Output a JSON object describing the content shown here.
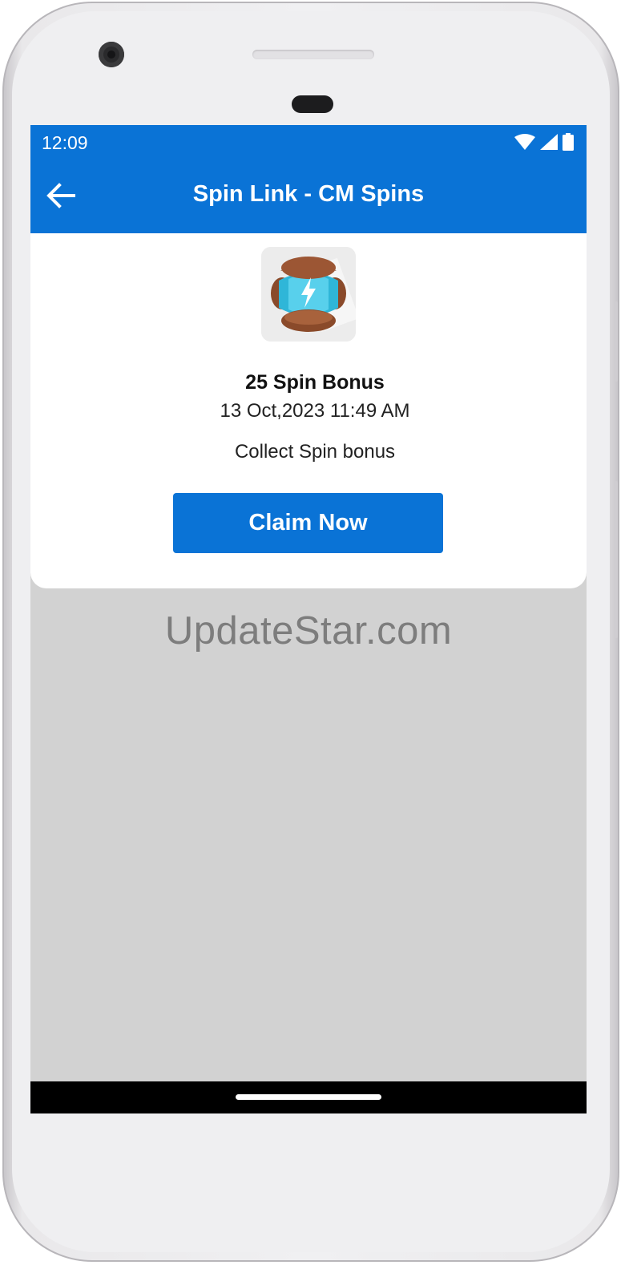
{
  "status_bar": {
    "time": "12:09",
    "icons": [
      "wifi-icon",
      "cellular-signal-icon",
      "battery-icon"
    ]
  },
  "app_bar": {
    "title": "Spin Link - CM Spins",
    "back_icon": "arrow-left-icon"
  },
  "card": {
    "image": "coin-master-spin-icon",
    "title": "25 Spin Bonus",
    "date": "13 Oct,2023 11:49 AM",
    "description": "Collect Spin bonus",
    "button_label": "Claim Now"
  },
  "watermark": "UpdateStar.com",
  "colors": {
    "primary": "#0a73d6",
    "background": "#d2d2d2",
    "card": "#ffffff"
  }
}
